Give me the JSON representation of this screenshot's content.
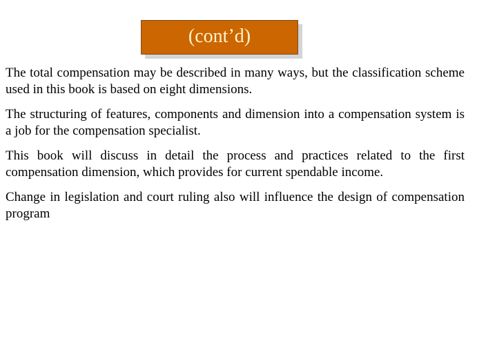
{
  "slide": {
    "title": "(cont’d)",
    "colors": {
      "title_background": "#cc6600",
      "title_text": "#fff3cc",
      "title_shadow": "#d4d4d4",
      "body_text": "#000000",
      "background": "#ffffff"
    },
    "paragraphs": [
      "The total compensation may be described in many ways, but the classification scheme used in this book is based on eight dimensions.",
      "The structuring of features, components and dimension into a compensation system is a job for the compensation specialist.",
      "This book will discuss in detail the process and practices related to the first compensation dimension, which provides for current spendable income.",
      "Change in legislation and court ruling also will influence the design of compensation program"
    ]
  }
}
